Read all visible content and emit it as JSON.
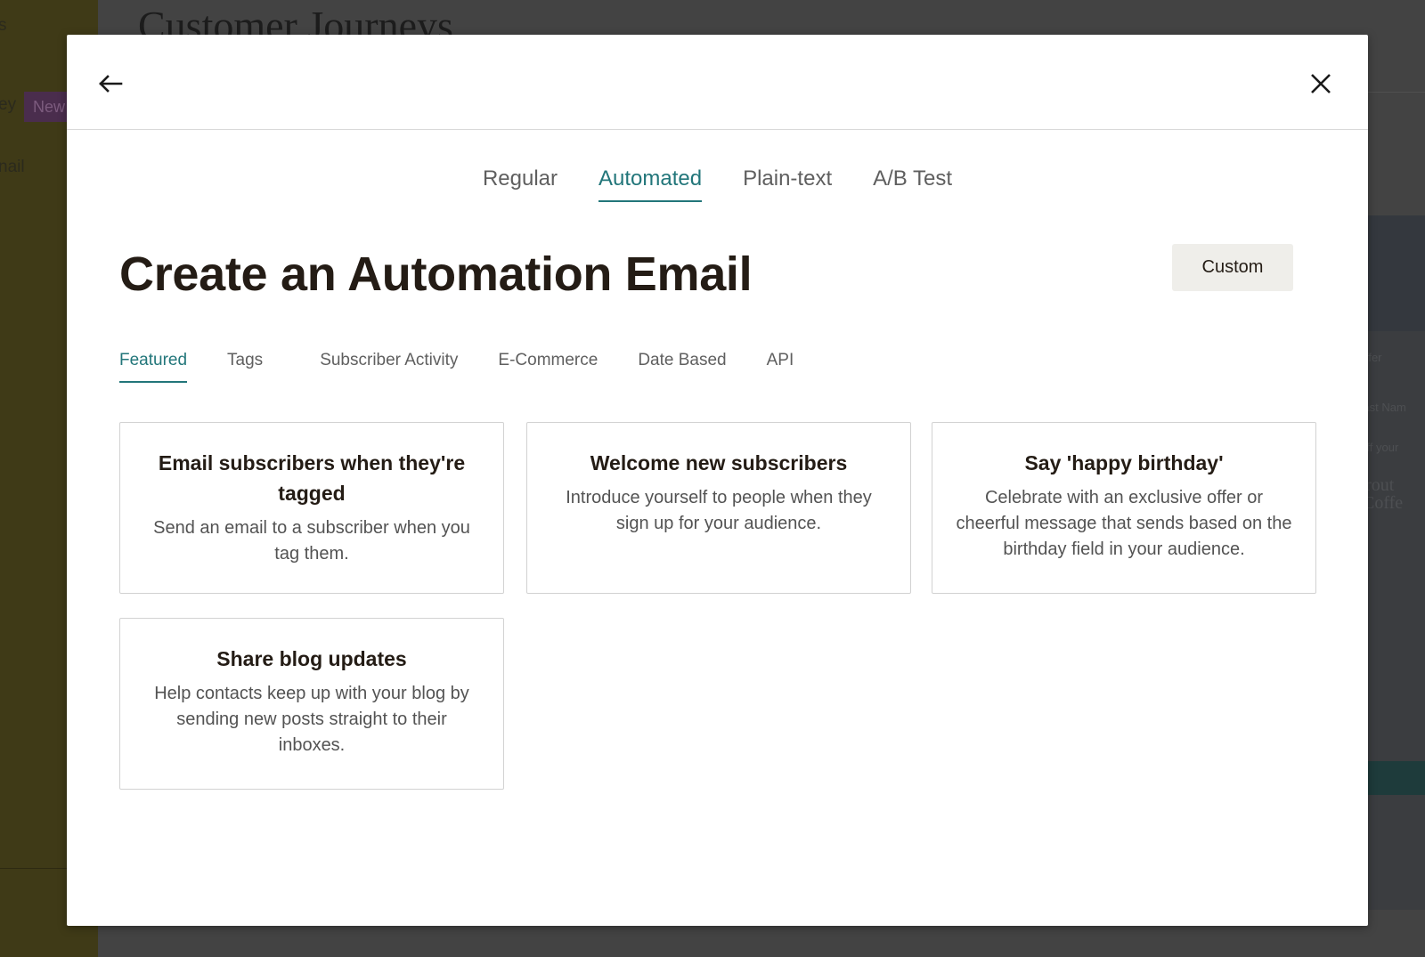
{
  "background": {
    "sidebar_fragments": [
      "s",
      "ey",
      "nail"
    ],
    "sidebar_badge": "New",
    "page_title": "Customer Journeys",
    "right_ghost_text": [
      "e Offer",
      "+ Last Nam",
      "% off your",
      "Sprout",
      "Coffe"
    ]
  },
  "modal": {
    "back_label": "Back",
    "close_label": "Close",
    "type_tabs": [
      {
        "label": "Regular",
        "active": false
      },
      {
        "label": "Automated",
        "active": true
      },
      {
        "label": "Plain-text",
        "active": false
      },
      {
        "label": "A/B Test",
        "active": false
      }
    ],
    "title": "Create an Automation Email",
    "custom_button": "Custom",
    "category_tabs": [
      {
        "label": "Featured",
        "active": true
      },
      {
        "label": "Tags",
        "active": false
      },
      {
        "label": "Subscriber Activity",
        "active": false
      },
      {
        "label": "E-Commerce",
        "active": false
      },
      {
        "label": "Date Based",
        "active": false
      },
      {
        "label": "API",
        "active": false
      }
    ],
    "cards": [
      {
        "title": "Email subscribers when they're tagged",
        "description": "Send an email to a subscriber when you tag them."
      },
      {
        "title": "Welcome new subscribers",
        "description": "Introduce yourself to people when they sign up for your audience."
      },
      {
        "title": "Say 'happy birthday'",
        "description": "Celebrate with an exclusive offer or cheerful message that sends based on the birthday field in your audience."
      },
      {
        "title": "Share blog updates",
        "description": "Help contacts keep up with your blog by sending new posts straight to their inboxes."
      }
    ]
  },
  "colors": {
    "accent": "#22767a",
    "text_dark": "#241c15",
    "button_bg": "#efeeea"
  }
}
